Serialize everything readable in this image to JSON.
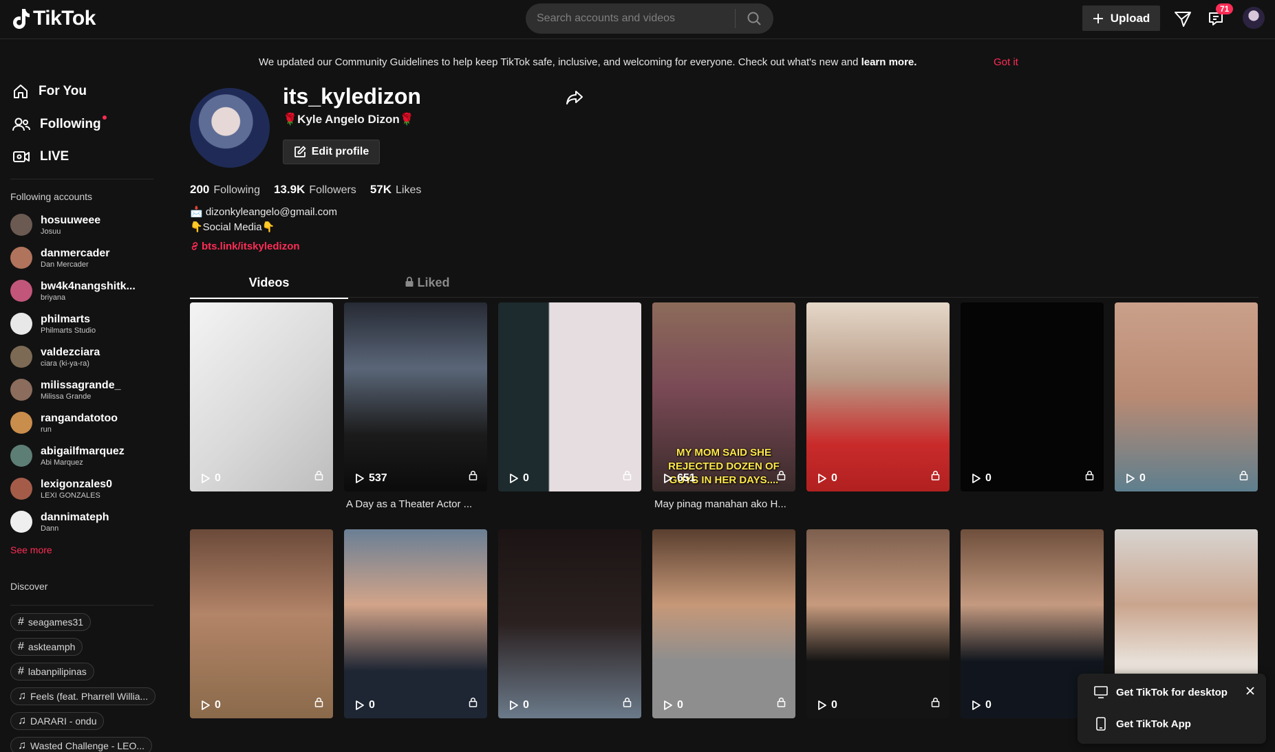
{
  "header": {
    "logo_text": "TikTok",
    "search_placeholder": "Search accounts and videos",
    "upload_label": "Upload",
    "inbox_badge": "71"
  },
  "sidebar": {
    "nav": [
      {
        "label": "For You"
      },
      {
        "label": "Following"
      },
      {
        "label": "LIVE"
      }
    ],
    "following_heading": "Following accounts",
    "accounts": [
      {
        "username": "hosuuweee",
        "nickname": "Josuu",
        "color": "#6b5a52"
      },
      {
        "username": "danmercader",
        "nickname": "Dan Mercader",
        "color": "#b0735c"
      },
      {
        "username": "bw4k4nangshitk...",
        "nickname": "briyana",
        "color": "#c2567a"
      },
      {
        "username": "philmarts",
        "nickname": "Philmarts Studio",
        "color": "#e8e8e8"
      },
      {
        "username": "valdezciara",
        "nickname": "ciara (ki-ya-ra)",
        "color": "#7c6a55"
      },
      {
        "username": "milissagrande_",
        "nickname": "Milissa Grande",
        "color": "#8b6c5d"
      },
      {
        "username": "rangandatotoo",
        "nickname": "run",
        "color": "#c98d4c"
      },
      {
        "username": "abigailfmarquez",
        "nickname": "Abi Marquez",
        "color": "#5d7e74"
      },
      {
        "username": "lexigonzales0",
        "nickname": "LEXI GONZALES",
        "color": "#a45c49"
      },
      {
        "username": "dannimateph",
        "nickname": "Dann",
        "color": "#efefef"
      }
    ],
    "see_more": "See more",
    "discover_heading": "Discover",
    "discover": [
      {
        "icon": "hashtag-icon",
        "label": "seagames31"
      },
      {
        "icon": "hashtag-icon",
        "label": "askteamph"
      },
      {
        "icon": "hashtag-icon",
        "label": "labanpilipinas"
      },
      {
        "icon": "music-note-icon",
        "label": "Feels (feat. Pharrell Willia..."
      },
      {
        "icon": "music-note-icon",
        "label": "DARARI - ondu"
      },
      {
        "icon": "music-note-icon",
        "label": "Wasted Challenge - LEO..."
      }
    ]
  },
  "notice": {
    "text": "We updated our Community Guidelines to help keep TikTok safe, inclusive, and welcoming for everyone. Check out what's new and ",
    "link": "learn more.",
    "dismiss": "Got it"
  },
  "profile": {
    "username": "its_kyledizon",
    "nickname": "🌹Kyle Angelo Dizon🌹",
    "edit_label": "Edit profile",
    "following_count": "200",
    "following_label": "Following",
    "followers_count": "13.9K",
    "followers_label": "Followers",
    "likes_count": "57K",
    "likes_label": "Likes",
    "bio_line1": "📩 dizonkyleangelo@gmail.com",
    "bio_line2": "👇Social Media👇",
    "link": "bts.link/itskyledizon"
  },
  "tabs": {
    "videos": "Videos",
    "liked": "Liked"
  },
  "videos": [
    {
      "views": "0",
      "caption": "",
      "overlay": "",
      "bg": "linear-gradient(135deg,#f4f4f4,#d9d9d9 55%,#bdbdbd)"
    },
    {
      "views": "537",
      "caption": "A Day as a Theater Actor ...",
      "overlay": "",
      "bg": "linear-gradient(180deg,#262a34,#5a6678 35%,#1b1b1b 70%,#0b0b0b)"
    },
    {
      "views": "0",
      "caption": "",
      "overlay": "",
      "bg": "linear-gradient(90deg,#1d2a2e 0 35%,#e6dde0 36% 100%)"
    },
    {
      "views": "651",
      "caption": "May pinag manahan ako H...",
      "overlay": "MY MOM SAID SHE REJECTED DOZEN OF GUYS IN HER DAYS....",
      "bg": "linear-gradient(180deg,#8c6b5a,#7a4a56 45%,#3a2a2a)"
    },
    {
      "views": "0",
      "caption": "",
      "overlay": "",
      "bg": "linear-gradient(180deg,#e5d8c9,#b89a86 40%,#c92b2b 75%,#b12020)"
    },
    {
      "views": "0",
      "caption": "",
      "overlay": "",
      "bg": "#050505"
    },
    {
      "views": "0",
      "caption": "",
      "overlay": "",
      "bg": "linear-gradient(180deg,#caa08a,#b98a73 50%,#5e7f8e)"
    },
    {
      "views": "0",
      "caption": "",
      "overlay": "",
      "bg": "linear-gradient(180deg,#6b4a3a,#b38468 45%,#8a6a4a)"
    },
    {
      "views": "0",
      "caption": "",
      "overlay": "",
      "bg": "linear-gradient(180deg,#6a7f95,#d2a489 40%,#1e2634 75%)"
    },
    {
      "views": "0",
      "caption": "",
      "overlay": "",
      "bg": "linear-gradient(180deg,#1c1414,#2b2121 50%,#6b7a8a)"
    },
    {
      "views": "0",
      "caption": "",
      "overlay": "",
      "bg": "linear-gradient(180deg,#5a3f2f,#c69878 40%,#8e8e8e 70%)"
    },
    {
      "views": "0",
      "caption": "",
      "overlay": "",
      "bg": "linear-gradient(180deg,#7d5f4e,#c69a7d 40%,#141414 70%)"
    },
    {
      "views": "0",
      "caption": "",
      "overlay": "",
      "bg": "linear-gradient(180deg,#6e4f3c,#c49a80 40%,#11161e 70%)"
    },
    {
      "views": "",
      "caption": "",
      "overlay": "",
      "bg": "linear-gradient(180deg,#d8d4d0,#caa58e 40%,#e8e0d8 70%)"
    }
  ],
  "popup": {
    "desktop": "Get TikTok for desktop",
    "app": "Get TikTok App"
  },
  "colors": {
    "accent": "#fe2c55",
    "background": "#121212"
  }
}
